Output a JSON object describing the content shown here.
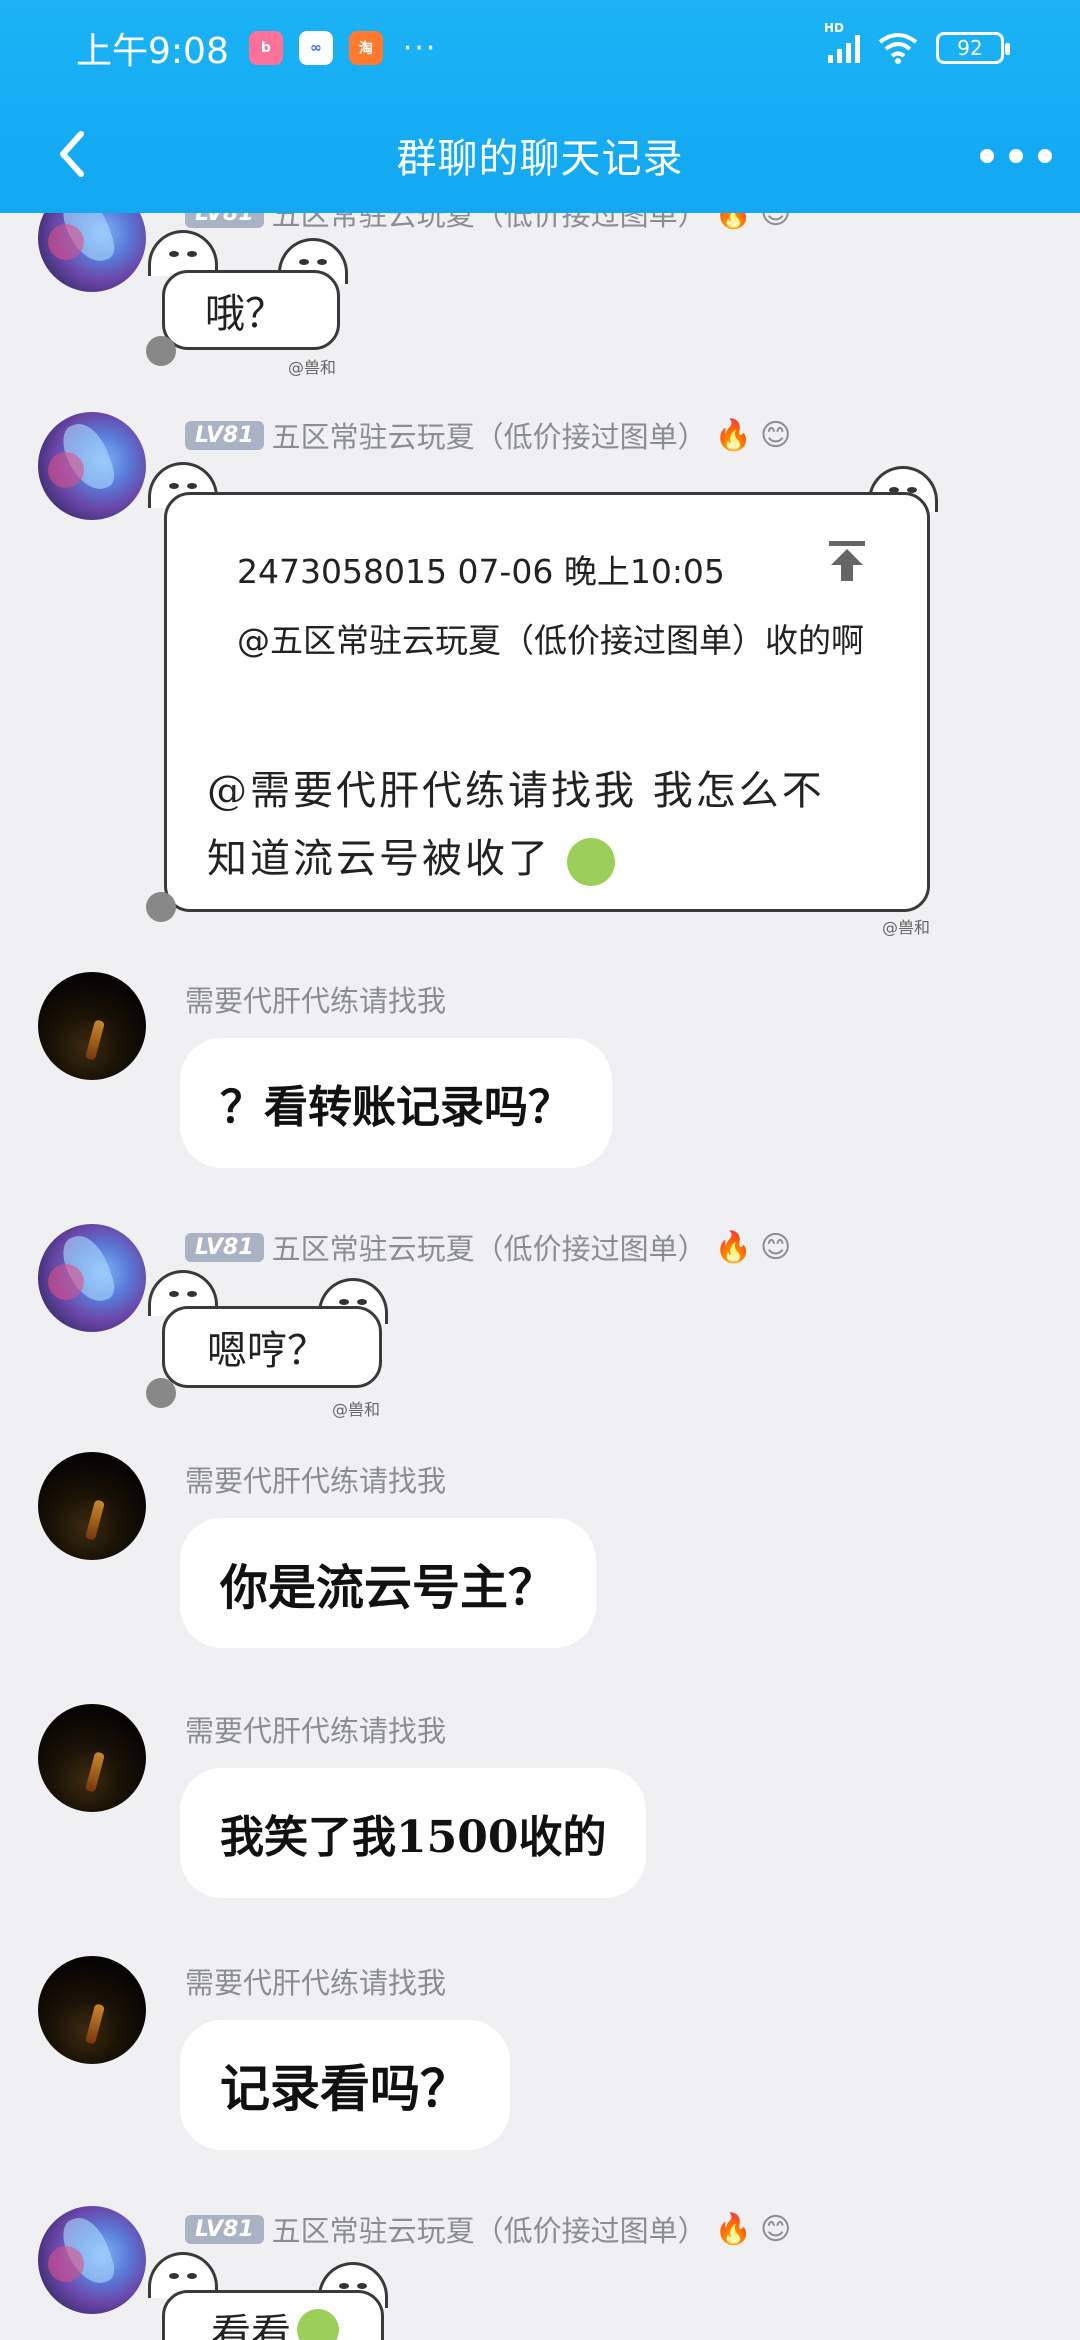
{
  "status_bar": {
    "time": "上午9:08",
    "apps": [
      "bilibili",
      "百度网盘",
      "淘宝"
    ],
    "more_dots": "···",
    "signal_label": "HD",
    "battery": "92"
  },
  "nav": {
    "title": "群聊的聊天记录"
  },
  "users": {
    "a_name": "五区常驻云玩夏（低价接过图单）",
    "a_level": "LV81",
    "b_name": "需要代肝代练请找我"
  },
  "messages": {
    "m1_text": "哦？",
    "m2_quote_header": "2473058015 07-06 晚上10:05",
    "m2_quote_body": "@五区常驻云玩夏（低价接过图单）收的啊",
    "m2_text_line1": "@需要代肝代练请找我 我怎么不",
    "m2_text_line2": "知道流云号被收了",
    "m3_text": "？看转账记录吗？",
    "m4_text": "嗯哼？",
    "m5_text": "你是流云号主？",
    "m6_text": "我笑了我1500收的",
    "m7_text": "记录看吗？",
    "m8_text": "看看"
  },
  "decor": {
    "sticker_sign": "@兽和"
  },
  "icons": {
    "back": "chevron-left-icon",
    "more": "more-dots-icon",
    "pin": "pin-top-icon",
    "fire": "fire-icon",
    "smile": "smile-icon"
  }
}
